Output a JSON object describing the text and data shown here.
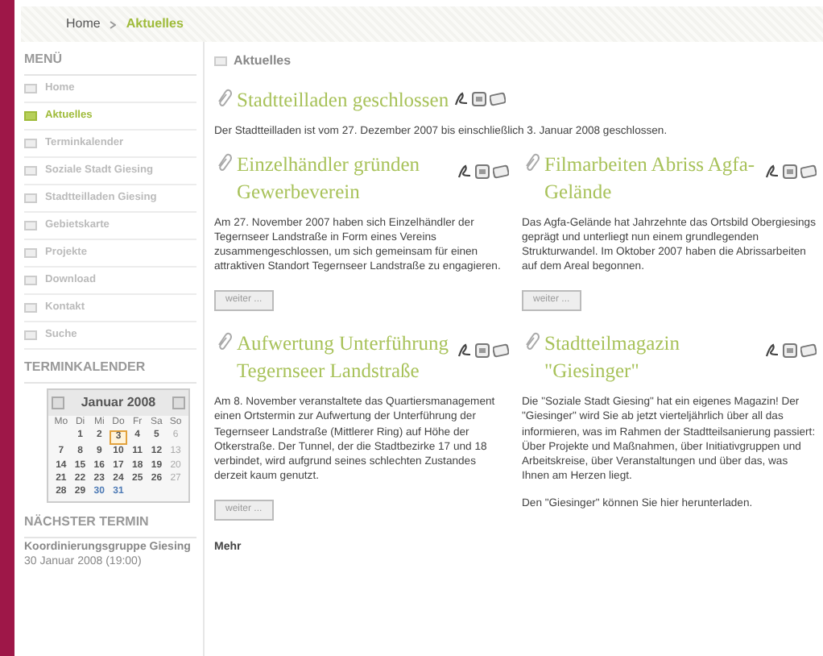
{
  "breadcrumb": [
    {
      "label": "Home",
      "selected": false
    },
    {
      "label": "Aktuelles",
      "selected": true
    }
  ],
  "sidebar": {
    "menu_title": "MENÜ",
    "items": [
      {
        "label": "Home",
        "selected": false
      },
      {
        "label": "Aktuelles",
        "selected": true
      },
      {
        "label": "Terminkalender",
        "selected": false
      },
      {
        "label": "Soziale Stadt Giesing",
        "selected": false
      },
      {
        "label": "Stadtteilladen Giesing",
        "selected": false
      },
      {
        "label": "Gebietskarte",
        "selected": false
      },
      {
        "label": "Projekte",
        "selected": false
      },
      {
        "label": "Download",
        "selected": false
      },
      {
        "label": "Kontakt",
        "selected": false
      },
      {
        "label": "Suche",
        "selected": false
      }
    ],
    "calendar_title": "TERMINKALENDER",
    "calendar": {
      "month": "Januar 2008",
      "weekdays": [
        "Mo",
        "Di",
        "Mi",
        "Do",
        "Fr",
        "Sa",
        "So"
      ],
      "weeks": [
        [
          {
            "day": "1",
            "kind": "weekday"
          },
          {
            "day": "2",
            "kind": "weekday"
          },
          {
            "day": "3",
            "kind": "today"
          },
          {
            "day": "4",
            "kind": "weekday"
          },
          {
            "day": "5",
            "kind": "weekday"
          },
          {
            "day": "6",
            "kind": "sunday"
          }
        ],
        [
          {
            "day": "7",
            "kind": "weekday"
          },
          {
            "day": "8",
            "kind": "weekday"
          },
          {
            "day": "9",
            "kind": "weekday"
          },
          {
            "day": "10",
            "kind": "weekday"
          },
          {
            "day": "11",
            "kind": "weekday"
          },
          {
            "day": "12",
            "kind": "weekday"
          },
          {
            "day": "13",
            "kind": "sunday"
          }
        ],
        [
          {
            "day": "14",
            "kind": "weekday"
          },
          {
            "day": "15",
            "kind": "weekday"
          },
          {
            "day": "16",
            "kind": "weekday"
          },
          {
            "day": "17",
            "kind": "weekday"
          },
          {
            "day": "18",
            "kind": "weekday"
          },
          {
            "day": "19",
            "kind": "weekday"
          },
          {
            "day": "20",
            "kind": "sunday"
          }
        ],
        [
          {
            "day": "21",
            "kind": "weekday"
          },
          {
            "day": "22",
            "kind": "weekday"
          },
          {
            "day": "23",
            "kind": "weekday"
          },
          {
            "day": "24",
            "kind": "weekday"
          },
          {
            "day": "25",
            "kind": "weekday"
          },
          {
            "day": "26",
            "kind": "weekday"
          },
          {
            "day": "27",
            "kind": "sunday"
          }
        ],
        [
          {
            "day": "28",
            "kind": "weekday"
          },
          {
            "day": "29",
            "kind": "weekday"
          },
          {
            "day": "30",
            "kind": "event"
          },
          {
            "day": "31",
            "kind": "event"
          }
        ]
      ]
    },
    "next_title": "NÄCHSTER TERMIN",
    "next_event": {
      "title": "Koordinierungsgruppe Giesing",
      "date": "30 Januar 2008 (19:00)"
    }
  },
  "main": {
    "heading": "Aktuelles",
    "articles": [
      {
        "kind": "full",
        "title": "Stadtteilladen geschlossen",
        "paragraphs": [
          "Der Stadtteilladen ist vom 27. Dezember 2007 bis einschließlich 3. Januar 2008 geschlossen."
        ]
      },
      {
        "kind": "column",
        "title": "Einzelhändler gründen Gewerbeverein",
        "paragraphs": [
          "Am 27. November 2007 haben sich Einzelhändler der Tegernseer Landstraße in Form eines Vereins zusammengeschlossen, um sich gemeinsam für einen attraktiven Standort Tegernseer Landstraße zu engagieren."
        ],
        "button": "weiter ..."
      },
      {
        "kind": "column",
        "title": "Filmarbeiten Abriss Agfa-Gelände",
        "paragraphs": [
          "Das Agfa-Gelände hat Jahrzehnte das Ortsbild Obergiesings geprägt und unterliegt nun einem grundlegenden Strukturwandel. Im Oktober 2007 haben die Abrissarbeiten auf dem Areal begonnen."
        ],
        "button": "weiter ..."
      },
      {
        "kind": "column",
        "title": "Aufwertung Unterführung Tegernseer Landstraße",
        "paragraphs": [
          "Am 8. November veranstaltete das Quartiersmanagement einen Ortstermin zur Aufwertung der Unterführung der Tegernseer Landstraße (Mittlerer Ring) auf Höhe der Otkerstraße. Der Tunnel, der die Stadtbezirke 17 und 18 verbindet, wird aufgrund seines schlechten Zustandes derzeit kaum genutzt."
        ],
        "button": "weiter ..."
      },
      {
        "kind": "column",
        "title": "Stadtteilmagazin \"Giesinger\"",
        "paragraphs": [
          "Die \"Soziale Stadt Giesing\" hat ein eigenes Magazin! Der \"Giesinger\" wird Sie ab jetzt vierteljährlich über all das informieren, was im Rahmen der Stadtteilsanierung passiert: Über Projekte und Maßnahmen, über Initiativgruppen und Arbeitskreise, über Veranstaltungen und über das, was Ihnen am Herzen liegt.",
          "Den \"Giesinger\" können Sie hier herunterladen."
        ]
      }
    ],
    "more": "Mehr"
  }
}
